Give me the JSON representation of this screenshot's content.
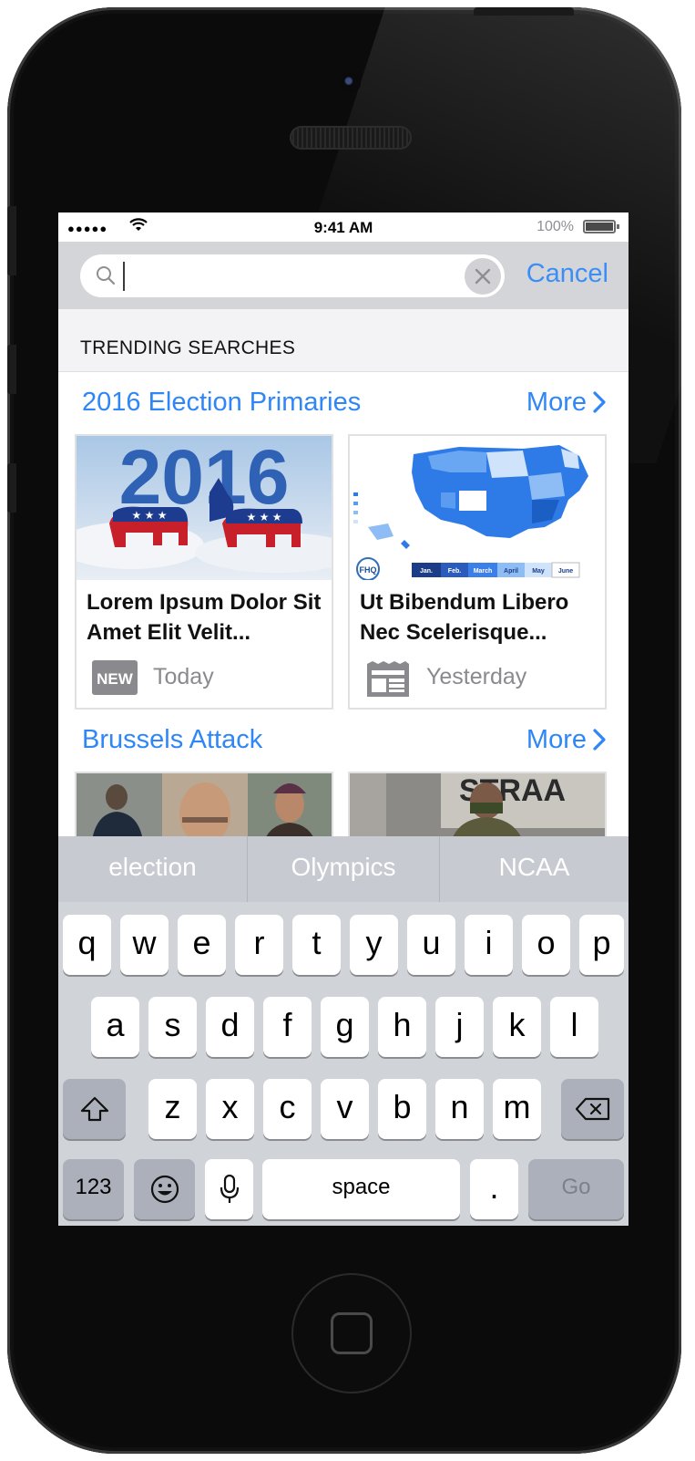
{
  "status_bar": {
    "time": "9:41 AM",
    "battery": "100%"
  },
  "search": {
    "placeholder": "",
    "cancel_label": "Cancel"
  },
  "trending": {
    "header": "TRENDING SEARCHES",
    "sections": [
      {
        "title": "2016 Election Primaries",
        "more_label": "More",
        "cards": [
          {
            "image_text": "2016",
            "headline": "Lorem Ipsum Dolor Sit Amet Elit Velit...",
            "badge": "NEW",
            "time": "Today"
          },
          {
            "image_text": "FHQ",
            "legend_months": [
              "Jan.",
              "Feb.",
              "March",
              "April",
              "May",
              "June"
            ],
            "headline": "Ut Bibendum Libero Nec Scelerisque...",
            "badge_icon": "newspaper-icon",
            "time": "Yesterday"
          }
        ]
      },
      {
        "title": "Brussels Attack",
        "more_label": "More",
        "image_text": "STRAA"
      }
    ]
  },
  "keyboard": {
    "suggestions": [
      "election",
      "Olympics",
      "NCAA"
    ],
    "row1": [
      "q",
      "w",
      "e",
      "r",
      "t",
      "y",
      "u",
      "i",
      "o",
      "p"
    ],
    "row2": [
      "a",
      "s",
      "d",
      "f",
      "g",
      "h",
      "j",
      "k",
      "l"
    ],
    "row3": [
      "z",
      "x",
      "c",
      "v",
      "b",
      "n",
      "m"
    ],
    "numbers_label": "123",
    "space_label": "space",
    "period_label": ".",
    "go_label": "Go"
  },
  "colors": {
    "accent": "#2f86f6",
    "keyboard_bg": "#d0d3d8",
    "searchbar_bg": "#d4d5d9"
  }
}
